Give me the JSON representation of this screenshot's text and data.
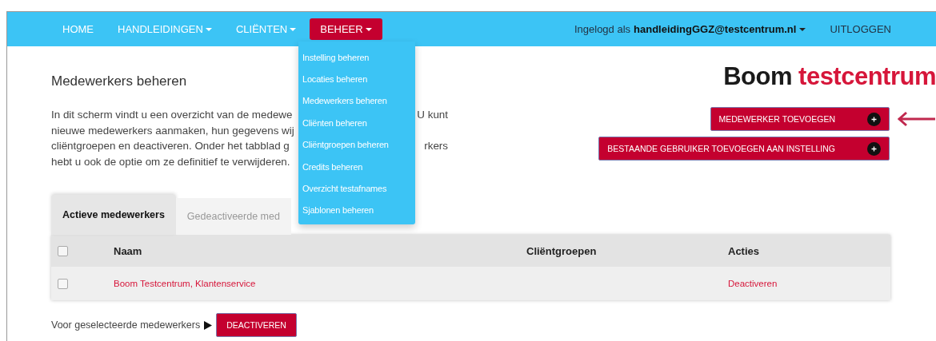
{
  "navbar": {
    "items": [
      {
        "label": "HOME",
        "has_caret": false,
        "selected": false
      },
      {
        "label": "HANDLEIDINGEN",
        "has_caret": true,
        "selected": false
      },
      {
        "label": "CLIËNTEN",
        "has_caret": true,
        "selected": false
      },
      {
        "label": "BEHEER",
        "has_caret": true,
        "selected": true
      }
    ],
    "user": "Ingelogd als **handleidingGGZ@testcentrum.nl**",
    "logout": "UITLOGGEN"
  },
  "dropdown": {
    "items": [
      "Instelling beheren",
      "Locaties beheren",
      "Medewerkers beheren",
      "Cliënten beheren",
      "Cliëntgroepen beheren",
      "Credits beheren",
      "Overzicht testafnames",
      "Sjablonen beheren"
    ]
  },
  "page_title": "Medewerkers beheren",
  "intro_lines": [
    {
      "left": "In dit scherm vindt u een overzicht van de medewe",
      "right": "U kunt"
    },
    {
      "left": "nieuwe medewerkers aanmaken, hun gegevens wij"
    },
    {
      "left": "cliëntgroepen en deactiveren. Onder het tabblad g",
      "right": "rkers"
    },
    {
      "left": "hebt u ook de optie om ze definitief te verwijderen."
    }
  ],
  "logo": [
    {
      "text": "Boom",
      "color": "#1a1a1a"
    },
    {
      "text": "testcentrum",
      "color": "#d6163a"
    }
  ],
  "action_buttons": [
    {
      "label": "MEDEWERKER TOEVOEGEN",
      "pointed": true
    },
    {
      "label": "BESTAANDE GEBRUIKER TOEVOEGEN AAN INSTELLING",
      "pointed": false
    }
  ],
  "tabs": [
    {
      "label": "Actieve medewerkers",
      "selected": true
    },
    {
      "label": "Gedeactiveerde med",
      "selected": false
    }
  ],
  "table": {
    "select_all_checked": false,
    "columns": [
      "Naam",
      "Cliëntgroepen",
      "Acties"
    ],
    "rows": [
      {
        "checked": false,
        "naam": "Boom Testcentrum, Klantenservice",
        "action": "Deactiveren"
      }
    ]
  },
  "bulk": {
    "label": "Voor geselecteerde medewerkers",
    "button": "DEACTIVEREN"
  }
}
